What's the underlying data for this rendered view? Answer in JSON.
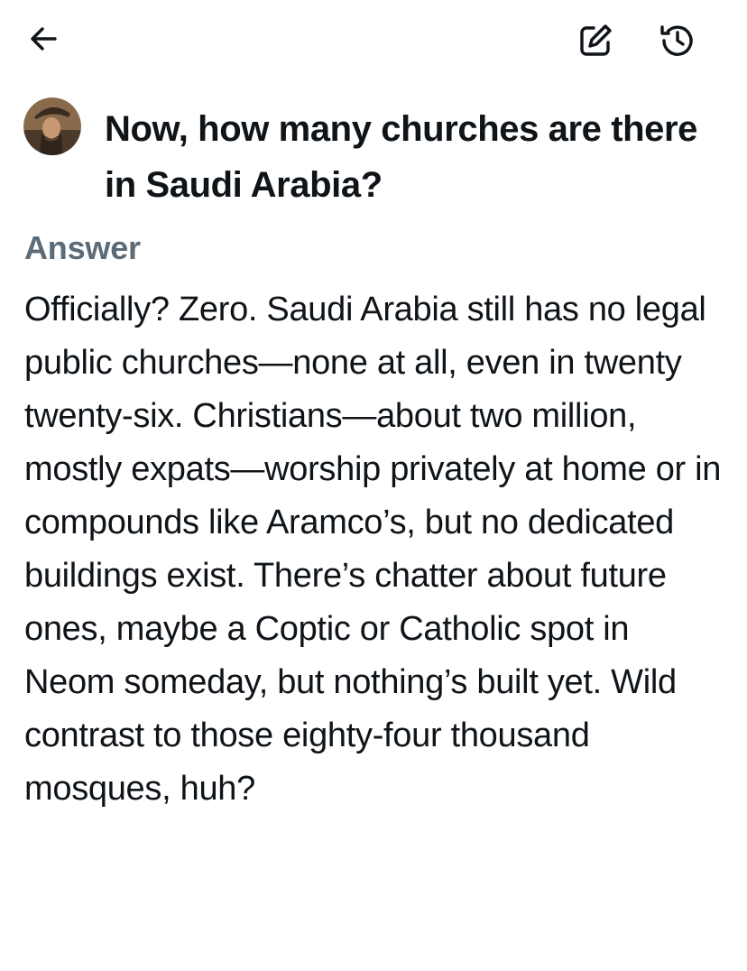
{
  "header": {
    "back_icon": "arrow-left-icon",
    "edit_icon": "edit-note-icon",
    "history_icon": "history-icon"
  },
  "question": {
    "avatar_icon": "user-avatar",
    "text": "Now, how many churches are there in Saudi Arabia?"
  },
  "answer": {
    "label": "Answer",
    "text": "Officially? Zero. Saudi Arabia still has no legal public churches—none at all, even in twenty twenty-six. Christians—about two million, mostly expats—worship privately at home or in compounds like Aramco’s, but no dedicated buildings exist. There’s chatter about future ones, maybe a Coptic or Catholic spot in Neom someday, but nothing’s built yet. Wild contrast to those eighty-four thousand mosques, huh?"
  },
  "colors": {
    "text": "#0f1419",
    "label": "#5b6b78",
    "background": "#ffffff"
  }
}
